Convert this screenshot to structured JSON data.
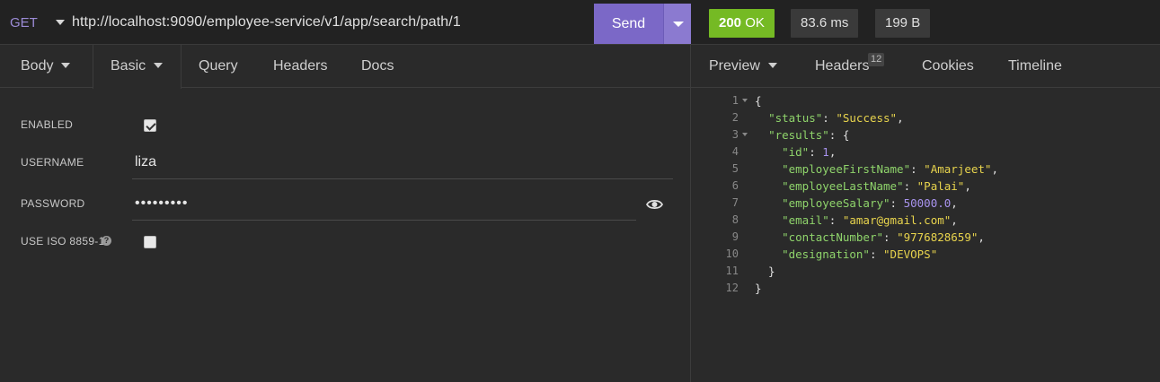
{
  "request": {
    "method": "GET",
    "url": "http://localhost:9090/employee-service/v1/app/search/path/1",
    "send_label": "Send",
    "tabs": [
      {
        "label": "Body"
      },
      {
        "label": "Basic"
      },
      {
        "label": "Query"
      },
      {
        "label": "Headers"
      },
      {
        "label": "Docs"
      }
    ],
    "auth": {
      "enabled_label": "ENABLED",
      "enabled": true,
      "username_label": "USERNAME",
      "username": "liza",
      "password_label": "PASSWORD",
      "password_masked": "•••••••••",
      "iso_label": "USE ISO 8859-1",
      "iso_enabled": false
    }
  },
  "response": {
    "status": {
      "code": "200",
      "text": "OK",
      "color": "#75ba24"
    },
    "time": "83.6 ms",
    "size": "199 B",
    "tabs": [
      {
        "label": "Preview"
      },
      {
        "label": "Headers",
        "count": "12"
      },
      {
        "label": "Cookies"
      },
      {
        "label": "Timeline"
      }
    ],
    "body_lines": [
      {
        "num": "1",
        "fold": true,
        "tokens": [
          {
            "t": "{",
            "c": "p"
          }
        ]
      },
      {
        "num": "2",
        "fold": false,
        "tokens": [
          {
            "t": "  ",
            "c": "p"
          },
          {
            "t": "\"status\"",
            "c": "k"
          },
          {
            "t": ": ",
            "c": "p"
          },
          {
            "t": "\"Success\"",
            "c": "s"
          },
          {
            "t": ",",
            "c": "p"
          }
        ]
      },
      {
        "num": "3",
        "fold": true,
        "tokens": [
          {
            "t": "  ",
            "c": "p"
          },
          {
            "t": "\"results\"",
            "c": "k"
          },
          {
            "t": ": {",
            "c": "p"
          }
        ]
      },
      {
        "num": "4",
        "fold": false,
        "tokens": [
          {
            "t": "    ",
            "c": "p"
          },
          {
            "t": "\"id\"",
            "c": "k"
          },
          {
            "t": ": ",
            "c": "p"
          },
          {
            "t": "1",
            "c": "n"
          },
          {
            "t": ",",
            "c": "p"
          }
        ]
      },
      {
        "num": "5",
        "fold": false,
        "tokens": [
          {
            "t": "    ",
            "c": "p"
          },
          {
            "t": "\"employeeFirstName\"",
            "c": "k"
          },
          {
            "t": ": ",
            "c": "p"
          },
          {
            "t": "\"Amarjeet\"",
            "c": "s"
          },
          {
            "t": ",",
            "c": "p"
          }
        ]
      },
      {
        "num": "6",
        "fold": false,
        "tokens": [
          {
            "t": "    ",
            "c": "p"
          },
          {
            "t": "\"employeeLastName\"",
            "c": "k"
          },
          {
            "t": ": ",
            "c": "p"
          },
          {
            "t": "\"Palai\"",
            "c": "s"
          },
          {
            "t": ",",
            "c": "p"
          }
        ]
      },
      {
        "num": "7",
        "fold": false,
        "tokens": [
          {
            "t": "    ",
            "c": "p"
          },
          {
            "t": "\"employeeSalary\"",
            "c": "k"
          },
          {
            "t": ": ",
            "c": "p"
          },
          {
            "t": "50000.0",
            "c": "n"
          },
          {
            "t": ",",
            "c": "p"
          }
        ]
      },
      {
        "num": "8",
        "fold": false,
        "tokens": [
          {
            "t": "    ",
            "c": "p"
          },
          {
            "t": "\"email\"",
            "c": "k"
          },
          {
            "t": ": ",
            "c": "p"
          },
          {
            "t": "\"amar@gmail.com\"",
            "c": "s"
          },
          {
            "t": ",",
            "c": "p"
          }
        ]
      },
      {
        "num": "9",
        "fold": false,
        "tokens": [
          {
            "t": "    ",
            "c": "p"
          },
          {
            "t": "\"contactNumber\"",
            "c": "k"
          },
          {
            "t": ": ",
            "c": "p"
          },
          {
            "t": "\"9776828659\"",
            "c": "s"
          },
          {
            "t": ",",
            "c": "p"
          }
        ]
      },
      {
        "num": "10",
        "fold": false,
        "tokens": [
          {
            "t": "    ",
            "c": "p"
          },
          {
            "t": "\"designation\"",
            "c": "k"
          },
          {
            "t": ": ",
            "c": "p"
          },
          {
            "t": "\"DEVOPS\"",
            "c": "s"
          }
        ]
      },
      {
        "num": "11",
        "fold": false,
        "tokens": [
          {
            "t": "  }",
            "c": "p"
          }
        ]
      },
      {
        "num": "12",
        "fold": false,
        "tokens": [
          {
            "t": "}",
            "c": "p"
          }
        ]
      }
    ]
  }
}
